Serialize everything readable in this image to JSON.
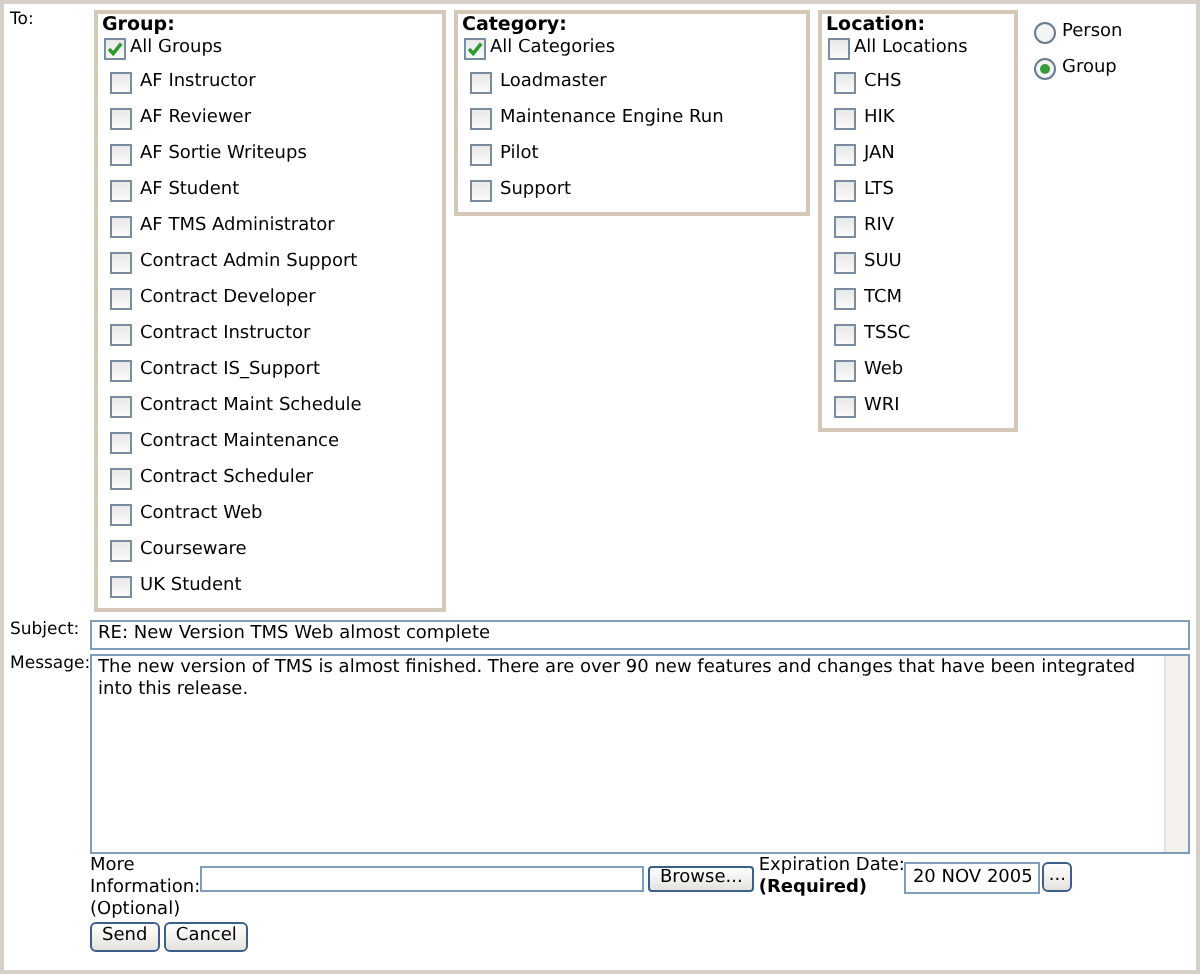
{
  "to_label": "To:",
  "groups": {
    "title": "Group:",
    "items": [
      {
        "label": "All Groups",
        "checked": true
      },
      {
        "label": "AF Instructor",
        "checked": false
      },
      {
        "label": "AF Reviewer",
        "checked": false
      },
      {
        "label": "AF Sortie Writeups",
        "checked": false
      },
      {
        "label": "AF Student",
        "checked": false
      },
      {
        "label": "AF TMS Administrator",
        "checked": false
      },
      {
        "label": "Contract Admin Support",
        "checked": false
      },
      {
        "label": "Contract Developer",
        "checked": false
      },
      {
        "label": "Contract Instructor",
        "checked": false
      },
      {
        "label": "Contract IS_Support",
        "checked": false
      },
      {
        "label": "Contract Maint Schedule",
        "checked": false
      },
      {
        "label": "Contract Maintenance",
        "checked": false
      },
      {
        "label": "Contract Scheduler",
        "checked": false
      },
      {
        "label": "Contract Web",
        "checked": false
      },
      {
        "label": "Courseware",
        "checked": false
      },
      {
        "label": "UK Student",
        "checked": false
      }
    ]
  },
  "categories": {
    "title": "Category:",
    "items": [
      {
        "label": "All Categories",
        "checked": true
      },
      {
        "label": "Loadmaster",
        "checked": false
      },
      {
        "label": "Maintenance Engine Run",
        "checked": false
      },
      {
        "label": "Pilot",
        "checked": false
      },
      {
        "label": "Support",
        "checked": false
      }
    ]
  },
  "locations": {
    "title": "Location:",
    "items": [
      {
        "label": "All Locations",
        "checked": false
      },
      {
        "label": "CHS",
        "checked": false
      },
      {
        "label": "HIK",
        "checked": false
      },
      {
        "label": "JAN",
        "checked": false
      },
      {
        "label": "LTS",
        "checked": false
      },
      {
        "label": "RIV",
        "checked": false
      },
      {
        "label": "SUU",
        "checked": false
      },
      {
        "label": "TCM",
        "checked": false
      },
      {
        "label": "TSSC",
        "checked": false
      },
      {
        "label": "Web",
        "checked": false
      },
      {
        "label": "WRI",
        "checked": false
      }
    ]
  },
  "recipient_type": [
    {
      "label": "Person",
      "selected": false
    },
    {
      "label": "Group",
      "selected": true
    }
  ],
  "subject": {
    "label": "Subject:",
    "value": "RE: New Version TMS Web almost complete"
  },
  "message": {
    "label": "Message:",
    "value": "The new version of TMS is almost finished.  There are over 90 new features and changes that have been integrated into this release."
  },
  "more_information": {
    "label": "More Information:",
    "note": "(Optional)",
    "browse_button": "Browse..."
  },
  "expiration_date": {
    "label": "Expiration Date:",
    "note": "(Required)",
    "value": "20 NOV 2005",
    "picker_button": "..."
  },
  "buttons": [
    "Send",
    "Cancel"
  ]
}
